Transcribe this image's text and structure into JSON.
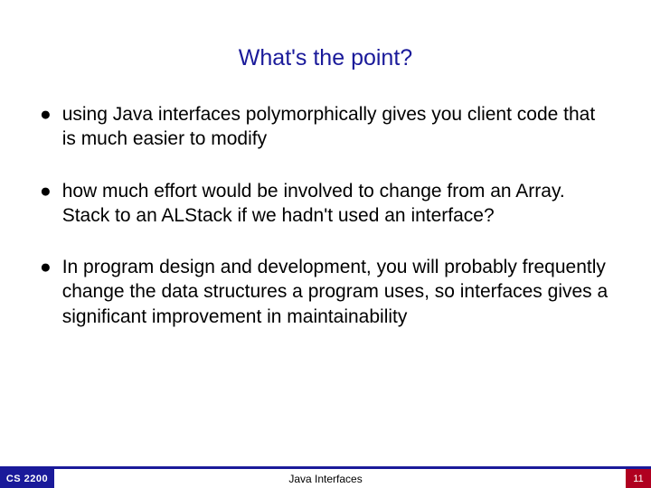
{
  "title": "What's the point?",
  "bullets": [
    "using Java interfaces polymorphically gives you client code that is much easier to modify",
    "how much effort would be involved to change from an Array. Stack to an ALStack if we hadn't used an interface?",
    "In program design and development, you will probably frequently change the data structures a program uses, so interfaces gives a significant improvement in maintainability"
  ],
  "footer": {
    "course": "CS 2200",
    "topic": "Java Interfaces",
    "page": "11"
  }
}
